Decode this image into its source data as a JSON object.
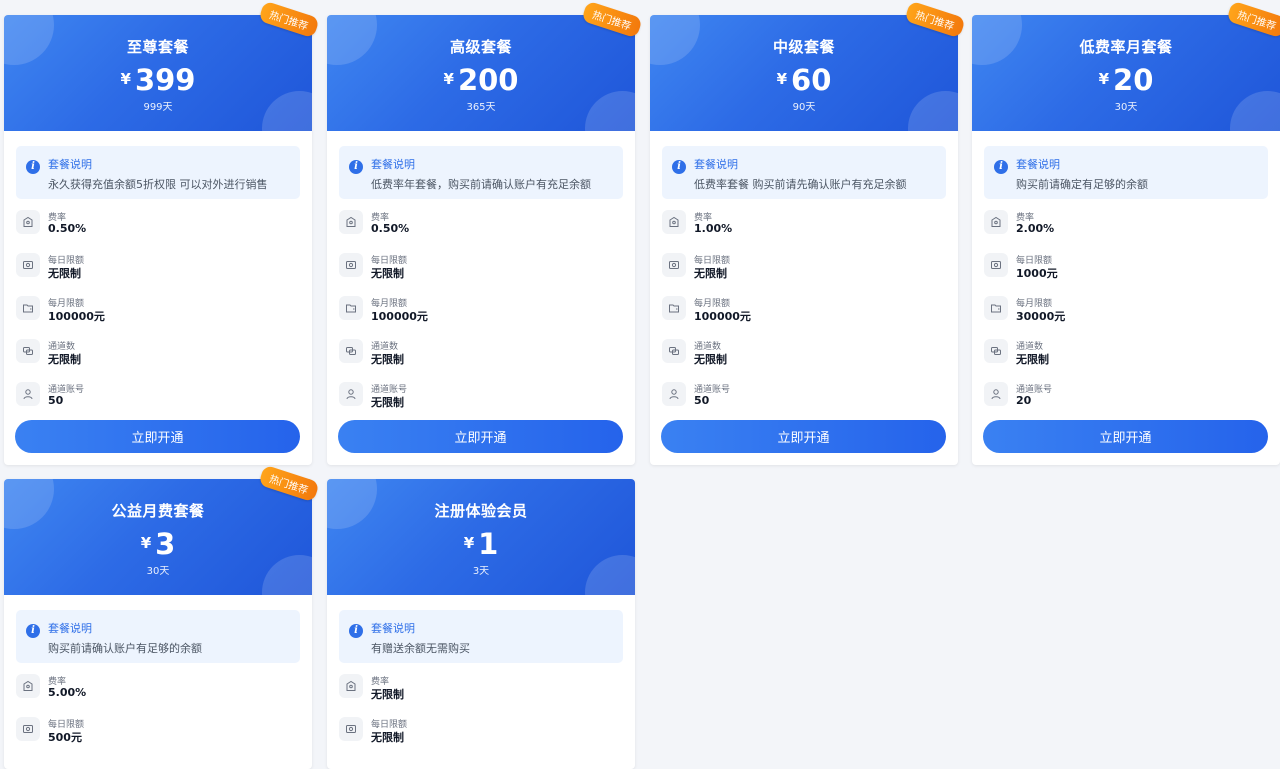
{
  "labels": {
    "ribbon": "热门推荐",
    "desc_title": "套餐说明",
    "rate": "费率",
    "daily_limit": "每日限额",
    "monthly_limit": "每月限额",
    "channels": "通道数",
    "channel_accounts": "通道账号",
    "activate": "立即开通",
    "currency": "¥"
  },
  "plans": [
    {
      "name": "至尊套餐",
      "price": "399",
      "days": "999天",
      "hot": true,
      "desc": "永久获得充值余额5折权限 可以对外进行销售",
      "rate": "0.50%",
      "daily": "无限制",
      "monthly": "100000元",
      "channels": "无限制",
      "accounts": "50"
    },
    {
      "name": "高级套餐",
      "price": "200",
      "days": "365天",
      "hot": true,
      "desc": "低费率年套餐，购买前请确认账户有充足余额",
      "rate": "0.50%",
      "daily": "无限制",
      "monthly": "100000元",
      "channels": "无限制",
      "accounts": "无限制"
    },
    {
      "name": "中级套餐",
      "price": "60",
      "days": "90天",
      "hot": true,
      "desc": "低费率套餐 购买前请先确认账户有充足余额",
      "rate": "1.00%",
      "daily": "无限制",
      "monthly": "100000元",
      "channels": "无限制",
      "accounts": "50"
    },
    {
      "name": "低费率月套餐",
      "price": "20",
      "days": "30天",
      "hot": true,
      "desc": "购买前请确定有足够的余额",
      "rate": "2.00%",
      "daily": "1000元",
      "monthly": "30000元",
      "channels": "无限制",
      "accounts": "20"
    },
    {
      "name": "公益月费套餐",
      "price": "3",
      "days": "30天",
      "hot": true,
      "desc": "购买前请确认账户有足够的余额",
      "rate": "5.00%",
      "daily": "500元"
    },
    {
      "name": "注册体验会员",
      "price": "1",
      "days": "3天",
      "hot": false,
      "desc": "有赠送余额无需购买",
      "rate": "无限制",
      "daily": "无限制"
    }
  ]
}
